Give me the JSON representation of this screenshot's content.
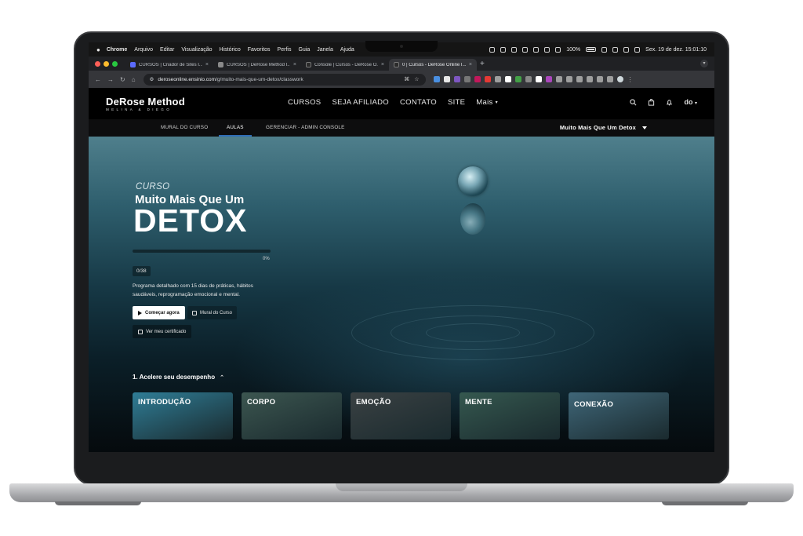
{
  "menubar": {
    "app": "Chrome",
    "items": [
      "Arquivo",
      "Editar",
      "Visualização",
      "Histórico",
      "Favoritos",
      "Perfis",
      "Guia",
      "Janela",
      "Ajuda"
    ],
    "battery": "100%",
    "datetime": "Sex. 19 de dez.  15:01:10"
  },
  "tabs": [
    {
      "label": "CURSOS | Criador de Sites I...",
      "favicon_color": "#5b6bff"
    },
    {
      "label": "CURSOS | DeRose Method I...",
      "favicon_color": "#8a8a8a"
    },
    {
      "label": "Console | Cursos - DeRose O...",
      "favicon_color": "#2b2b2b"
    },
    {
      "label": "0 | Cursos - DeRose Online I...",
      "favicon_color": "#2b2b2b"
    }
  ],
  "toolbar": {
    "url_host": "deroseonline.ensinio.com",
    "url_path": "/g/muito-mais-que-um-detox/classwork"
  },
  "site": {
    "logo_main": "DeRose Method",
    "logo_sub": "MELINA & DIEGO",
    "nav": [
      "CURSOS",
      "SEJA AFILIADO",
      "CONTATO",
      "SITE"
    ],
    "nav_more": "Mais",
    "user_badge": "do"
  },
  "subnav": {
    "items": [
      "MURAL DO CURSO",
      "AULAS",
      "GERENCIAR - ADMIN CONSOLE"
    ],
    "active_index": 1,
    "course_select": "Muito Mais Que Um Detox"
  },
  "hero": {
    "kicker": "CURSO",
    "title": "Muito Mais Que Um",
    "big_title": "DETOX",
    "progress_fraction": 0.0,
    "progress_label": "0%",
    "lesson_count": "0/38",
    "description": "Programa detalhado com 15 dias de práticas, hábitos saudáveis, reprogramação emocional e mental.",
    "start_button": "Começar agora",
    "mural_button": "Mural do Curso",
    "certificate_button": "Ver meu certificado"
  },
  "module": {
    "title": "1. Acelere seu desempenho",
    "cards": [
      {
        "title": "INTRODUÇÃO",
        "color": "#2f7d96"
      },
      {
        "title": "CORPO",
        "color": "#3c5650"
      },
      {
        "title": "EMOÇÃO",
        "color": "#3a4143"
      },
      {
        "title": "MENTE",
        "color": "#35584f"
      },
      {
        "title": "CONEXÃO",
        "color": "#3f6678"
      }
    ]
  },
  "dock": {
    "icon_colors": [
      "#3d8bfd",
      "#5e5ce6",
      "#e5e5e5",
      "#ff9f0a",
      "#ffffff",
      "#ffffff",
      "#bf5af2",
      "#1c1c1e",
      "#ffffff",
      "#f2f2f7",
      "#30d158",
      "#0a84ff",
      "#ffffff",
      "#34c759",
      "#ff375f",
      "#0a84ff",
      "#0a84ff",
      "#8e8e93",
      "#ff453a",
      "#ff9f0a",
      "#bf5af2",
      "#ffd60a",
      "#64d2ff",
      "#0a84ff",
      "#5e5ce6",
      "#30d158",
      "#ff9f0a",
      "#ac8e68",
      "#0a84ff",
      "#2c2c2e",
      "#5856d6",
      "#0a84ff",
      "#ffffff",
      "#34c759",
      "#ff453a",
      "#ff9f0a",
      "#ffd60a",
      "#30d158",
      "#64d2ff",
      "#0a84ff",
      "#5e5ce6",
      "#bf5af2",
      "#ff375f",
      "#2c2c2e",
      "#34c759",
      "#9b59b6",
      "#e74c3c",
      "#ff9f0a",
      "#2ecc71",
      "#1abc9c",
      "#3498db",
      "#9b59b6",
      "#31a8ff",
      "#ff61f6",
      "#00c8ff",
      "#9999ff",
      "#ea77ff",
      "#ffc20e",
      "#31a8ff",
      "#ff9a00",
      "#d0d0d0",
      "#8e8e93",
      "#ff453a",
      "#ffd60a",
      "#30d158",
      "#0a84ff",
      "#bf5af2",
      "#64d2ff",
      "#ff9f0a",
      "#8e8e93",
      "#c7c7cc"
    ]
  }
}
